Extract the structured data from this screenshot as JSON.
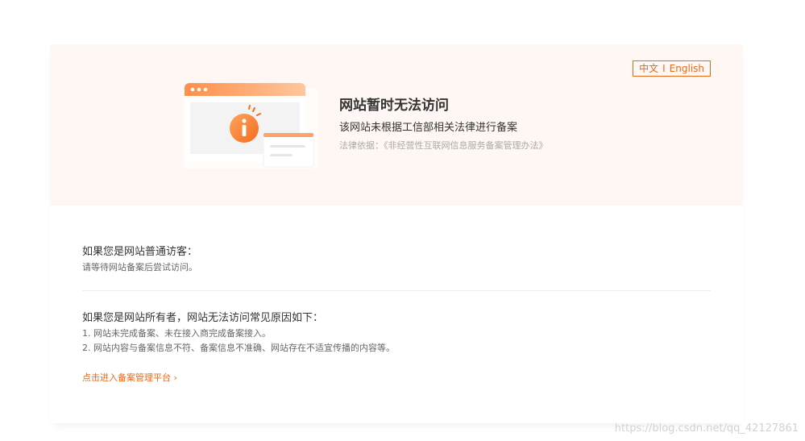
{
  "lang_switch": {
    "zh_label": "中文",
    "separator": "I",
    "en_label": "English"
  },
  "banner": {
    "title": "网站暂时无法访问",
    "subtitle": "该网站未根据工信部相关法律进行备案",
    "law": "法律依据：《非经营性互联网信息服务备案管理办法》"
  },
  "visitor": {
    "heading": "如果您是网站普通访客：",
    "text": "请等待网站备案后尝试访问。"
  },
  "owner": {
    "heading": "如果您是网站所有者，网站无法访问常见原因如下：",
    "reasons": [
      "1. 网站未完成备案、未在接入商完成备案接入。",
      "2. 网站内容与备案信息不符、备案信息不准确、网站存在不适宜传播的内容等。"
    ]
  },
  "platform_link": {
    "label": "点击进入备案管理平台",
    "chevron": "›"
  },
  "watermark": "https://blog.csdn.net/qq_42127861",
  "colors": {
    "accent": "#e8691a",
    "banner_bg": "#fff7f3",
    "muted": "#aaaaaa"
  },
  "icons": {
    "illustration": "warning-info-window-icon",
    "link_arrow": "chevron-right-icon"
  }
}
